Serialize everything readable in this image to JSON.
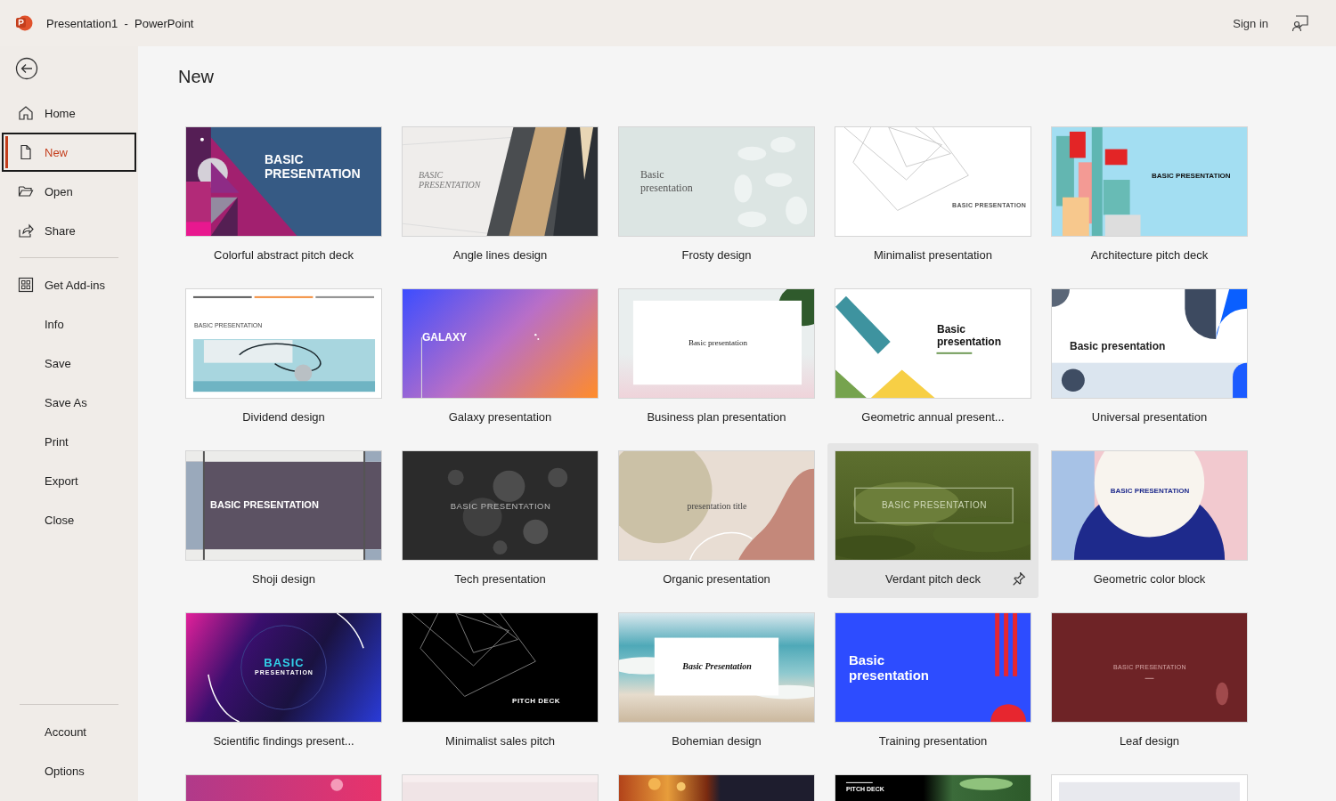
{
  "title_bar": {
    "title": "Presentation1  -  PowerPoint",
    "sign_in": "Sign in"
  },
  "sidebar": {
    "groups": [
      [
        {
          "label": "Home",
          "selected": false
        },
        {
          "label": "New",
          "selected": true
        },
        {
          "label": "Open",
          "selected": false
        },
        {
          "label": "Share",
          "selected": false
        }
      ],
      [
        {
          "label": "Get Add-ins",
          "selected": false
        },
        {
          "label": "Info",
          "selected": false
        },
        {
          "label": "Save",
          "selected": false
        },
        {
          "label": "Save As",
          "selected": false
        },
        {
          "label": "Print",
          "selected": false
        },
        {
          "label": "Export",
          "selected": false
        },
        {
          "label": "Close",
          "selected": false
        }
      ],
      [
        {
          "label": "Account",
          "selected": false
        },
        {
          "label": "Options",
          "selected": false
        }
      ]
    ]
  },
  "page_title": "New",
  "templates": [
    {
      "kind": "colorful",
      "name": "Colorful abstract pitch deck",
      "slide_text": [
        "BASIC PRESENTATION"
      ],
      "hovered": false
    },
    {
      "kind": "angle",
      "name": "Angle lines design",
      "slide_text": [
        "BASIC PRESENTATION"
      ],
      "hovered": false
    },
    {
      "kind": "frosty",
      "name": "Frosty design",
      "slide_text": [
        "Basic presentation"
      ],
      "hovered": false
    },
    {
      "kind": "minimal",
      "name": "Minimalist presentation",
      "slide_text": [
        "BASIC PRESENTATION"
      ],
      "hovered": false
    },
    {
      "kind": "architecture",
      "name": "Architecture pitch deck",
      "slide_text": [
        "BASIC PRESENTATION"
      ],
      "hovered": false
    },
    {
      "kind": "dividend",
      "name": "Dividend design",
      "slide_text": [
        "BASIC PRESENTATION"
      ],
      "hovered": false
    },
    {
      "kind": "galaxy",
      "name": "Galaxy presentation",
      "slide_text": [
        "GALAXY"
      ],
      "hovered": false
    },
    {
      "kind": "business",
      "name": "Business plan presentation",
      "slide_text": [
        "Basic presentation"
      ],
      "hovered": false
    },
    {
      "kind": "geometric",
      "name": "Geometric annual present...",
      "slide_text": [
        "Basic presentation"
      ],
      "hovered": false
    },
    {
      "kind": "universal",
      "name": "Universal presentation",
      "slide_text": [
        "Basic presentation"
      ],
      "hovered": false
    },
    {
      "kind": "shoji",
      "name": "Shoji design",
      "slide_text": [
        "BASIC PRESENTATION"
      ],
      "hovered": false
    },
    {
      "kind": "tech",
      "name": "Tech presentation",
      "slide_text": [
        "BASIC PRESENTATION"
      ],
      "hovered": false
    },
    {
      "kind": "organic",
      "name": "Organic presentation",
      "slide_text": [
        "presentation title"
      ],
      "hovered": false
    },
    {
      "kind": "verdant",
      "name": "Verdant pitch deck",
      "slide_text": [
        "BASIC PRESENTATION"
      ],
      "hovered": true
    },
    {
      "kind": "colorblock",
      "name": "Geometric color block",
      "slide_text": [
        "BASIC PRESENTATION"
      ],
      "hovered": false
    },
    {
      "kind": "scientific",
      "name": "Scientific findings present...",
      "slide_text": [
        "BASIC",
        "PRESENTATION"
      ],
      "hovered": false
    },
    {
      "kind": "sales",
      "name": "Minimalist sales pitch",
      "slide_text": [
        "PITCH DECK"
      ],
      "hovered": false
    },
    {
      "kind": "bohemian",
      "name": "Bohemian design",
      "slide_text": [
        "Basic Presentation"
      ],
      "hovered": false
    },
    {
      "kind": "training",
      "name": "Training presentation",
      "slide_text": [
        "Basic presentation"
      ],
      "hovered": false
    },
    {
      "kind": "leaf",
      "name": "Leaf design",
      "slide_text": [
        "BASIC PRESENTATION"
      ],
      "hovered": false
    },
    {
      "kind": "pink",
      "hovered": false
    },
    {
      "kind": "blush",
      "hovered": false
    },
    {
      "kind": "fire",
      "hovered": false
    },
    {
      "kind": "pitch",
      "slide_text": [
        "PITCH DECK"
      ],
      "hovered": false
    },
    {
      "kind": "pale",
      "hovered": false
    }
  ]
}
